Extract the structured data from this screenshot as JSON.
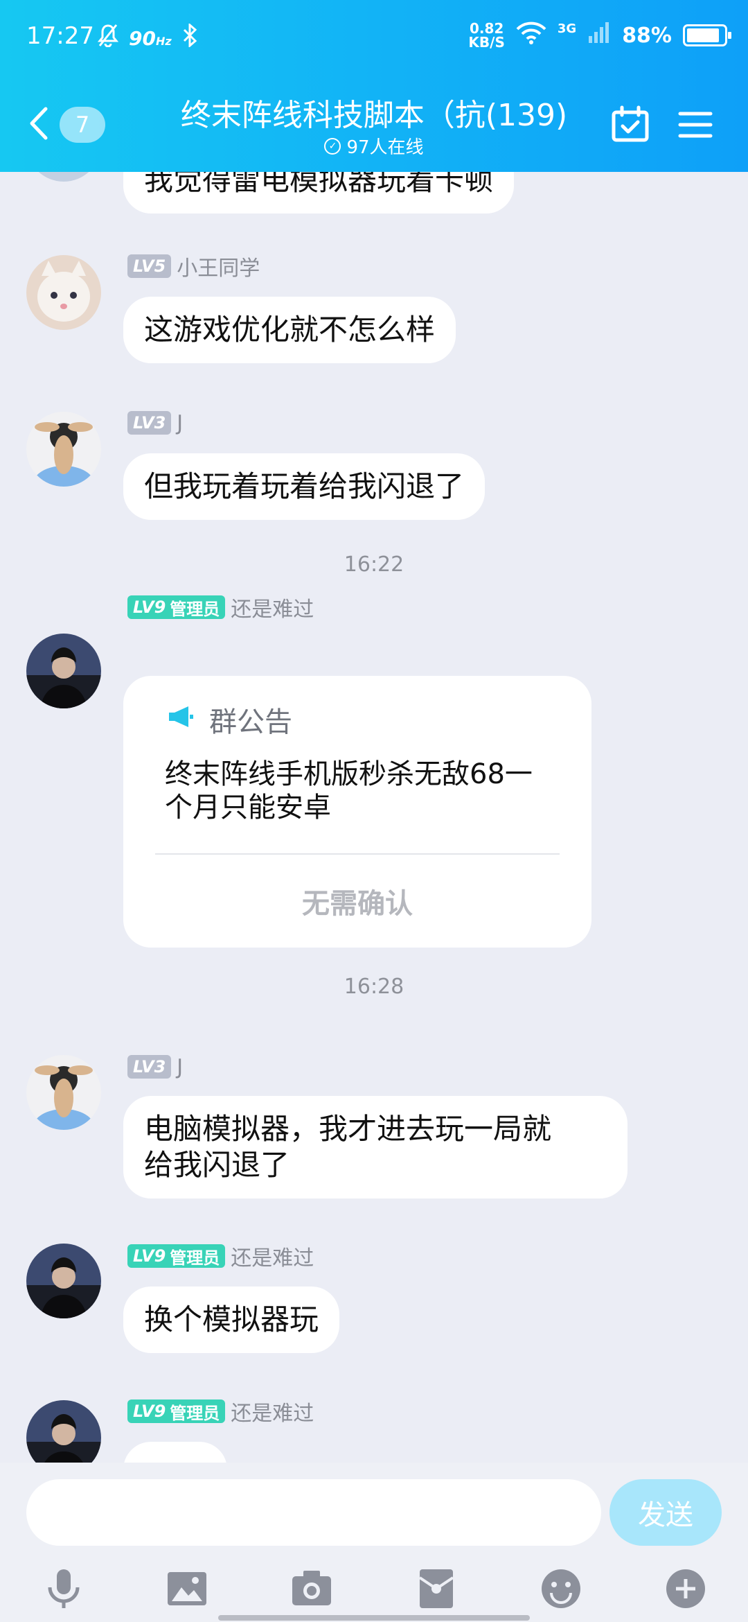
{
  "status_bar": {
    "time": "17:27",
    "refresh_rate": "90",
    "refresh_unit": "Hz",
    "speed_value": "0.82",
    "speed_unit": "KB/S",
    "network": "3G",
    "battery": "88%"
  },
  "header": {
    "unread_count": "7",
    "title": "终末阵线科技脚本（抗(139)",
    "online": "97人在线"
  },
  "messages": [
    {
      "text": "我觉得雷电模拟器玩着卡顿"
    },
    {
      "level": "LV5",
      "nick": "小王同学",
      "text": "这游戏优化就不怎么样"
    },
    {
      "level": "LV3",
      "nick": "J",
      "text": "但我玩着玩着给我闪退了"
    },
    {
      "time": "16:22"
    },
    {
      "level": "LV9",
      "role": "管理员",
      "nick": "还是难过",
      "notice": {
        "title": "群公告",
        "body_line1": "终末阵线手机版秒杀无敌68一",
        "body_line2": "个月只能安卓",
        "confirm": "无需确认"
      }
    },
    {
      "time": "16:28"
    },
    {
      "level": "LV3",
      "nick": "J",
      "text_line1": "电脑模拟器，我才进去玩一局就",
      "text_line2": "给我闪退了"
    },
    {
      "level": "LV9",
      "role": "管理员",
      "nick": "还是难过",
      "text": "换个模拟器玩"
    },
    {
      "level": "LV9",
      "role": "管理员",
      "nick": "还是难过"
    }
  ],
  "input": {
    "placeholder": "",
    "send_label": "发送"
  },
  "toolbar": {
    "icons": [
      "microphone-icon",
      "image-icon",
      "camera-icon",
      "red-packet-icon",
      "emoji-icon",
      "plus-icon"
    ]
  },
  "colors": {
    "header_gradient_start": "#16c8f2",
    "header_gradient_end": "#0ea0f8",
    "admin_badge": "#38d3b7",
    "level_badge": "#b8bdcc",
    "send_button": "#a8e6fb",
    "chat_background": "#ebedf5"
  }
}
